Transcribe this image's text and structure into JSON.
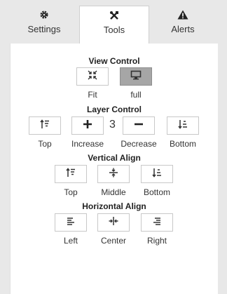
{
  "tabs": [
    {
      "label": "Settings",
      "icon": "gear-icon",
      "active": false
    },
    {
      "label": "Tools",
      "icon": "tools-icon",
      "active": true
    },
    {
      "label": "Alerts",
      "icon": "warning-icon",
      "active": false
    }
  ],
  "view_control": {
    "title": "View Control",
    "buttons": [
      {
        "label": "Fit",
        "icon": "compress-icon",
        "selected": false
      },
      {
        "label": "full",
        "icon": "monitor-icon",
        "selected": true
      }
    ]
  },
  "layer_control": {
    "title": "Layer Control",
    "value": "3",
    "buttons": [
      {
        "label": "Top",
        "icon": "sort-top-icon"
      },
      {
        "label": "Increase",
        "icon": "plus-icon"
      },
      {
        "label": "Decrease",
        "icon": "minus-icon"
      },
      {
        "label": "Bottom",
        "icon": "sort-bottom-icon"
      }
    ]
  },
  "vertical_align": {
    "title": "Vertical Align",
    "buttons": [
      {
        "label": "Top",
        "icon": "align-top-icon"
      },
      {
        "label": "Middle",
        "icon": "align-middle-icon"
      },
      {
        "label": "Bottom",
        "icon": "align-bottom-icon"
      }
    ]
  },
  "horizontal_align": {
    "title": "Horizontal Align",
    "buttons": [
      {
        "label": "Left",
        "icon": "align-left-icon"
      },
      {
        "label": "Center",
        "icon": "align-center-icon"
      },
      {
        "label": "Right",
        "icon": "align-right-icon"
      }
    ]
  }
}
